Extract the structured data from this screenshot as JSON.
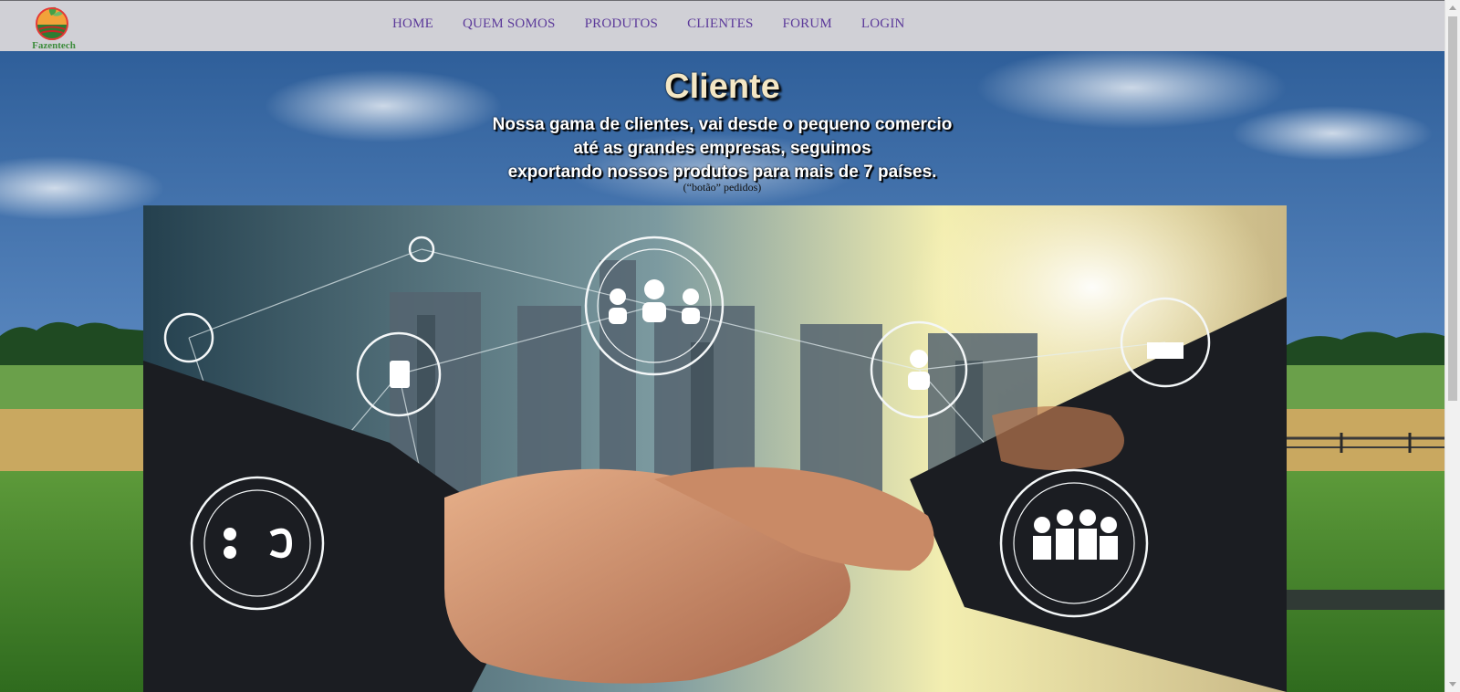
{
  "header": {
    "logo_text": "Fazentech",
    "nav": [
      {
        "label": "HOME"
      },
      {
        "label": "QUEM SOMOS"
      },
      {
        "label": "PRODUTOS"
      },
      {
        "label": "CLIENTES"
      },
      {
        "label": "FORUM"
      },
      {
        "label": "LOGIN"
      }
    ]
  },
  "hero": {
    "title": "Cliente",
    "lines": [
      "Nossa gama de clientes, vai desde o pequeno comercio",
      "até as grandes empresas, seguimos",
      "exportando nossos produtos para mais de 7 países."
    ],
    "orders_button": "(“botão” pedidos)"
  },
  "colors": {
    "header_bg": "#d0d0d6",
    "nav_link": "#5c3a9a",
    "title": "#f4e7c4",
    "logo_text": "#3c8c3c"
  },
  "icons": [
    "app-logo-icon",
    "scroll-up-arrow-icon",
    "scroll-down-arrow-icon",
    "handshake-network-image",
    "farm-field-background-image"
  ]
}
